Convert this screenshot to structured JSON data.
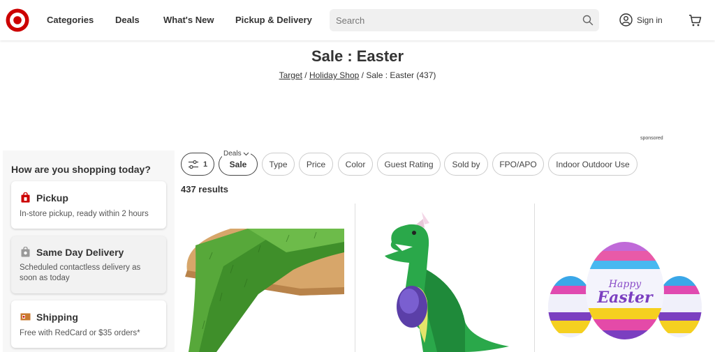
{
  "header": {
    "nav": [
      "Categories",
      "Deals",
      "What's New",
      "Pickup & Delivery"
    ],
    "search_placeholder": "Search",
    "sign_in": "Sign in",
    "brand_color": "#cc0000"
  },
  "page": {
    "title": "Sale : Easter",
    "breadcrumb": {
      "crumb1": "Target",
      "sep1": " / ",
      "crumb2": "Holiday Shop",
      "current": " / Sale : Easter (437)"
    },
    "sponsored": "sponsored"
  },
  "sidebar": {
    "heading": "How are you shopping today?",
    "options": [
      {
        "title": "Pickup",
        "desc": "In-store pickup, ready within 2 hours",
        "icon": "store-bag-icon"
      },
      {
        "title": "Same Day Delivery",
        "desc": "Scheduled contactless delivery as soon as today",
        "icon": "delivery-bag-icon"
      },
      {
        "title": "Shipping",
        "desc": "Free with RedCard or $35 orders*",
        "icon": "shipping-box-icon"
      }
    ]
  },
  "filters": {
    "filter_count": "1",
    "deals_label": "Deals",
    "sale_chip": "Sale",
    "chips": [
      "Type",
      "Price",
      "Color",
      "Guest Rating",
      "Sold by",
      "FPO/APO",
      "Indoor Outdoor Use"
    ]
  },
  "results_label": "437 results",
  "products": [
    {
      "image": "grass-table-runner"
    },
    {
      "image": "inflatable-dinosaur-with-egg"
    },
    {
      "image": "inflatable-easter-eggs",
      "image_text": "Happy Easter"
    }
  ]
}
